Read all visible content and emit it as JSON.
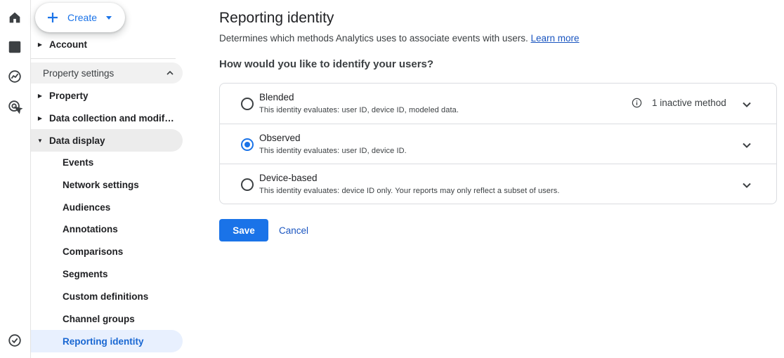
{
  "rail": {
    "icons": [
      "home-icon",
      "reports-icon",
      "explore-icon",
      "advertising-icon",
      "admin-check-icon"
    ]
  },
  "nav": {
    "create_label": "Create",
    "account_label": "Account",
    "property_settings_label": "Property settings",
    "property_label": "Property",
    "data_collection_label": "Data collection and modifica…",
    "data_display_label": "Data display",
    "items": [
      {
        "label": "Events"
      },
      {
        "label": "Network settings"
      },
      {
        "label": "Audiences"
      },
      {
        "label": "Annotations"
      },
      {
        "label": "Comparisons"
      },
      {
        "label": "Segments"
      },
      {
        "label": "Custom definitions"
      },
      {
        "label": "Channel groups"
      },
      {
        "label": "Reporting identity"
      }
    ],
    "selected_item": "Reporting identity"
  },
  "main": {
    "title": "Reporting identity",
    "description": "Determines which methods Analytics uses to associate events with users.",
    "learn_more": "Learn more",
    "question": "How would you like to identify your users?",
    "options": [
      {
        "title": "Blended",
        "subtitle": "This identity evaluates: user ID, device ID, modeled data.",
        "selected": false,
        "note": "1 inactive method"
      },
      {
        "title": "Observed",
        "subtitle": "This identity evaluates: user ID, device ID.",
        "selected": true
      },
      {
        "title": "Device-based",
        "subtitle": "This identity evaluates: device ID only. Your reports may only reflect a subset of users.",
        "selected": false
      }
    ],
    "save_label": "Save",
    "cancel_label": "Cancel"
  },
  "colors": {
    "accent": "#1a73e8",
    "link": "#1a55c0",
    "selected_nav_bg": "#e8f0fe",
    "group_bg": "#ececec"
  }
}
